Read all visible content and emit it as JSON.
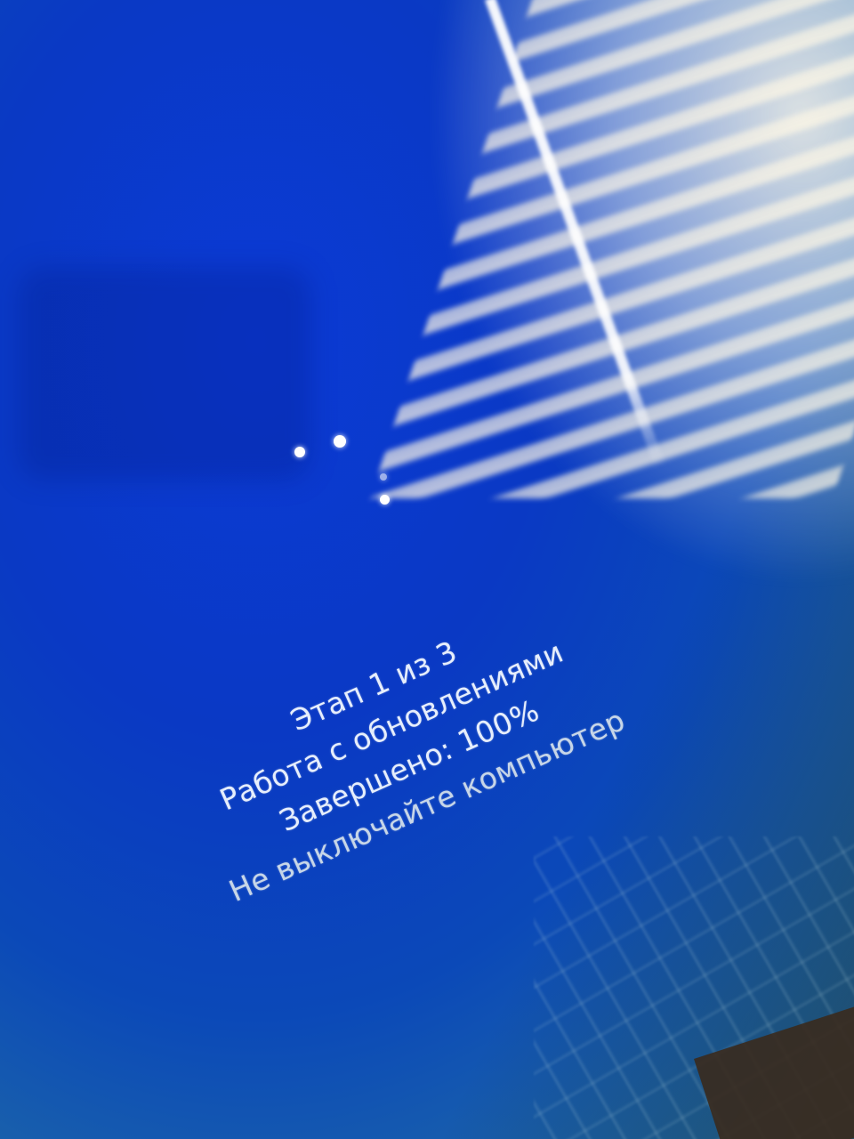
{
  "update_screen": {
    "stage": "Этап 1 из 3",
    "activity": "Работа с обновлениями",
    "progress_text": "Завершено: 100%",
    "progress_percent": 100,
    "warning": "Не выключайте компьютер"
  },
  "colors": {
    "background": "#0a3fb0",
    "text": "#e6eefc",
    "spinner": "#ffffff"
  },
  "icons": {
    "spinner": "loading-dots-icon"
  }
}
